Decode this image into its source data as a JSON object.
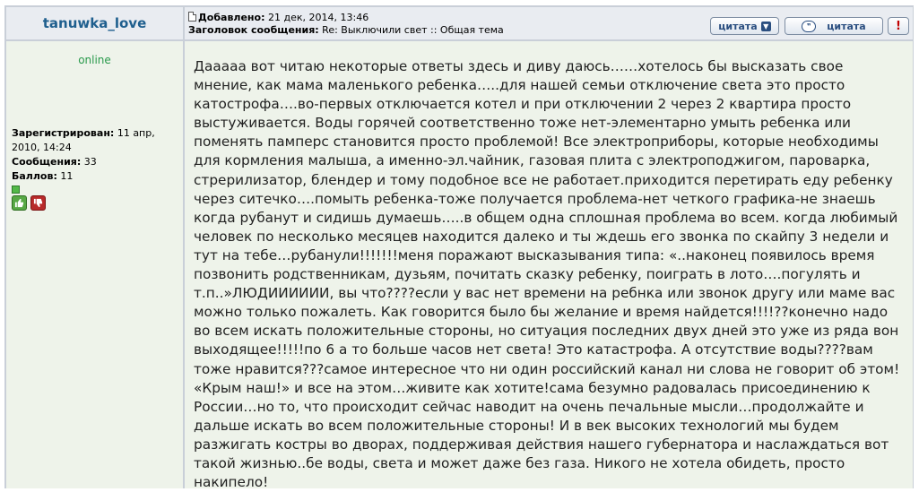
{
  "author": {
    "username": "tanuwka_love",
    "status": "online",
    "registered_label": "Зарегистрирован:",
    "registered_value": " 11 апр, 2010, 14:24",
    "posts_label": "Сообщения:",
    "posts_value": " 33",
    "points_label": "Баллов:",
    "points_value": " 11"
  },
  "post": {
    "added_label": "Добавлено:",
    "added_value": " 21 дек, 2014, 13:46",
    "subject_label": "Заголовок сообщения:",
    "subject_value": " Re: Выключили свет :: Общая тема",
    "body": "Дааааа вот читаю некоторые ответы здесь и диву даюсь……хотелось бы высказать свое мнение, как мама маленького ребенка…..для нашей семьи отключение света это просто катострофа….во-первых отключается котел и при отключении 2 через 2 квартира просто выстуживается. Воды горячей соответственно тоже нет-элементарно умыть ребенка или поменять памперс становится просто проблемой! Все электроприборы, которые необходимы для кормления малыша, а именно-эл.чайник, газовая плита с электроподжигом, пароварка, стрерилизатор, блендер и тому подобное все не работает.приходится перетирать еду ребенку через ситечко….помыть ребенка-тоже получается проблема-нет четкого графика-не знаешь когда рубанут и сидишь думаешь…..в общем одна сплошная проблема во всем. когда любимый человек по несколько месяцев находится далеко и ты ждешь его звонка по скайпу 3 недели и тут на тебе…рубанули!!!!!!!меня поражают высказывания типа: «..наконец появилось время позвонить родственникам, дузьям, почитать сказку ребенку, поиграть в лото….погулять и т.п..»ЛЮДИИИИИИ, вы что????если у вас нет времени на ребнка или звонок другу или маме вас можно только пожалеть. Как говорится было бы желание и время найдется!!!!??конечно надо во всем искать положительные стороны, но ситуация последних двух дней это уже из ряда вон выходящее!!!!!по 6 а то больше часов нет света! Это катастрофа. А отсутствие воды????вам тоже нравится???самое интересное что ни один российский канал ни слова не говорит об этом! «Крым наш!» и все на этом…живите как хотите!сама безумно радовалась присоединению к России…но то, что происходит сейчас наводит на очень печальные мысли…продолжайте и дальше искать во всем положительные стороны! И в век высоких технологий мы будем разжигать костры во дворах, поддерживая действия нашего губернатора и наслаждаться вот такой жизнью..бе воды, света и может даже без газа. Никого не хотела обидеть, просто накипело!"
  },
  "buttons": {
    "quote_label": "цитата",
    "quote2_label": "цитата",
    "report_label": "!"
  },
  "icons": {
    "post": "document-icon",
    "quote": "chevron-down-icon",
    "quote2": "speech-bubble-icon",
    "report": "exclamation-icon",
    "rank": "rank-square-icon",
    "vote_up": "thumbs-up-icon",
    "vote_down": "thumbs-down-icon"
  },
  "colors": {
    "username": "#1f5f8e",
    "online": "#2a9a4c",
    "header_bg": "#e9ecf1",
    "body_bg": "#eef3ea",
    "border": "#c9cfd8"
  }
}
